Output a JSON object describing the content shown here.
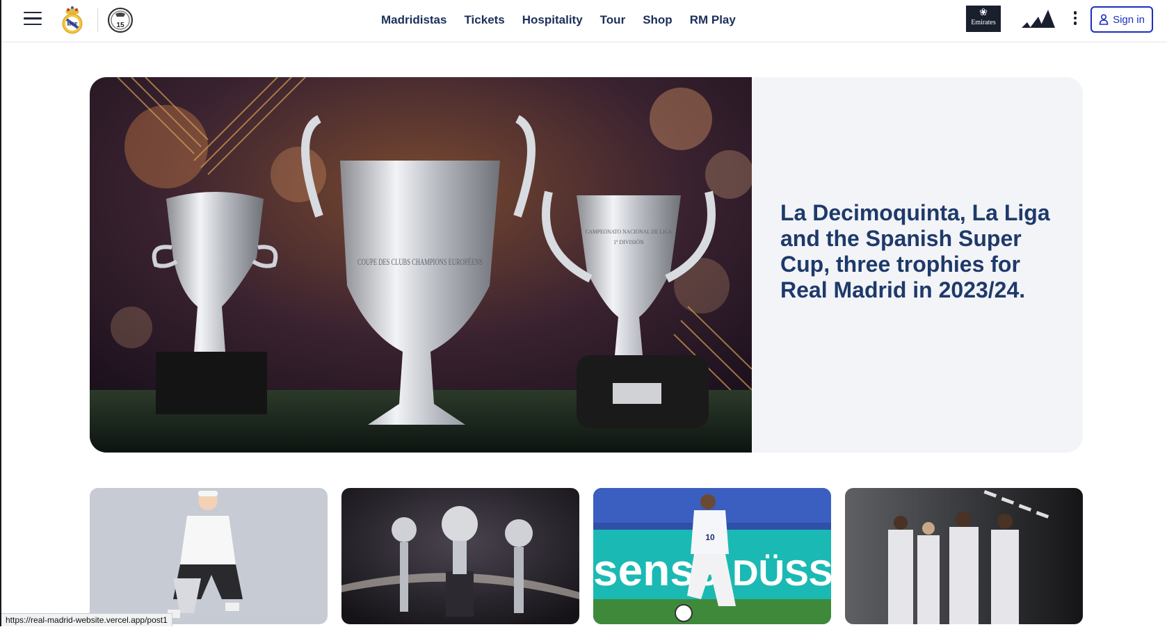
{
  "header": {
    "menu_icon": "hamburger-icon",
    "crest_icon": "real-madrid-crest-icon",
    "badge_number": "15",
    "nav": [
      "Madridistas",
      "Tickets",
      "Hospitality",
      "Tour",
      "Shop",
      "RM Play"
    ],
    "sponsor_emirates": "Emirates",
    "sponsor_adidas_icon": "adidas-logo-icon",
    "more_icon": "kebab-menu-icon",
    "signin_label": "Sign in",
    "user_icon": "user-icon"
  },
  "hero": {
    "title": "La Decimoquinta, La Liga and the Spanish Super Cup, three trophies for Real Madrid in 2023/24.",
    "image": "trophies-photo",
    "trophy_inscriptions": [
      "COUPE DES CLUBS CHAMPIONS EUROPÉENS",
      "CAMPEONATO NACIONAL DE LIGA",
      "1ª DIVISIÓN"
    ]
  },
  "cards": [
    {
      "image": "player-with-trophy-photo"
    },
    {
      "image": "three-basketball-trophies-photo"
    },
    {
      "image": "player-dribbling-photo",
      "jersey_number": "10",
      "board_texts": [
        "sense",
        "DÜSSEL"
      ]
    },
    {
      "image": "team-in-tunnel-photo"
    }
  ],
  "status": {
    "url": "https://real-madrid-website.vercel.app/post1"
  }
}
